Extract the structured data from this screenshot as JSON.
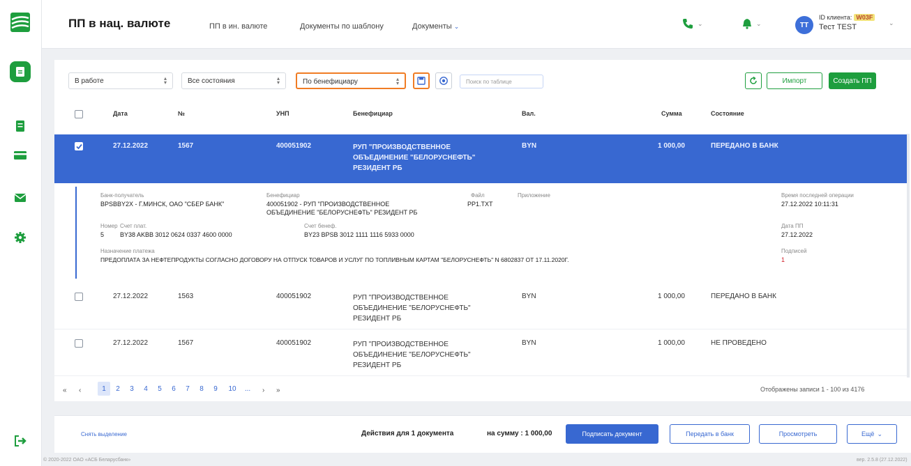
{
  "header": {
    "title": "ПП в нац. валюте",
    "nav": [
      "ПП в ин. валюте",
      "Документы по шаблону",
      "Документы"
    ],
    "client_id_label": "ID клиента:",
    "client_id_value": "W03F",
    "client_name": "Тест TEST",
    "avatar_initials": "TT"
  },
  "filters": {
    "work": "В работе",
    "states": "Все состояния",
    "group_by": "По бенефициару",
    "search_placeholder": "Поиск по таблице"
  },
  "toolbar": {
    "import": "Импорт",
    "create": "Создать ПП"
  },
  "table": {
    "headers": [
      "Дата",
      "№",
      "УНП",
      "Бенефициар",
      "Вал.",
      "Сумма",
      "Состояние"
    ],
    "rows": [
      {
        "checked": true,
        "date": "27.12.2022",
        "num": "1567",
        "unp": "400051902",
        "benef": [
          "РУП \"ПРОИЗВОДСТВЕННОЕ",
          "ОБЪЕДИНЕНИЕ \"БЕЛОРУСНЕФТЬ\"",
          "РЕЗИДЕНТ РБ"
        ],
        "cur": "BYN",
        "sum": "1 000,00",
        "state": "ПЕРЕДАНО В БАНК"
      },
      {
        "checked": false,
        "date": "27.12.2022",
        "num": "1563",
        "unp": "400051902",
        "benef": [
          "РУП \"ПРОИЗВОДСТВЕННОЕ",
          "ОБЪЕДИНЕНИЕ \"БЕЛОРУСНЕФТЬ\"",
          "РЕЗИДЕНТ РБ"
        ],
        "cur": "BYN",
        "sum": "1 000,00",
        "state": "ПЕРЕДАНО В БАНК"
      },
      {
        "checked": false,
        "date": "27.12.2022",
        "num": "1567",
        "unp": "400051902",
        "benef": [
          "РУП \"ПРОИЗВОДСТВЕННОЕ",
          "ОБЪЕДИНЕНИЕ \"БЕЛОРУСНЕФТЬ\"",
          "РЕЗИДЕНТ РБ"
        ],
        "cur": "BYN",
        "sum": "1 000,00",
        "state": "НЕ ПРОВЕДЕНО"
      }
    ]
  },
  "detail": {
    "bank_label": "Банк-получатель",
    "bank_value": "BPSBBY2X - Г.МИНСК, ОАО \"СБЕР БАНК\"",
    "benef_label": "Бенефициар",
    "benef_value_1": "400051902 - РУП \"ПРОИЗВОДСТВЕННОЕ",
    "benef_value_2": "ОБЪЕДИНЕНИЕ \"БЕЛОРУСНЕФТЬ\" РЕЗИДЕНТ РБ",
    "file_label": "Файл",
    "file_value": "PP1.TXT",
    "attach_label": "Приложение",
    "last_op_label": "Время последней операции",
    "last_op_value": "27.12.2022 10:11:31",
    "number_label": "Номер",
    "number_value": "5",
    "payer_acc_label": "Счет плат.",
    "payer_acc_value": "BY38 AKBB 3012 0624 0337 4600 0000",
    "benef_acc_label": "Счет бенеф.",
    "benef_acc_value": "BY23 BPSB 3012 1111 1116 5933 0000",
    "pp_date_label": "Дата ПП",
    "pp_date_value": "27.12.2022",
    "purpose_label": "Назначение платежа",
    "purpose_value": "ПРЕДОПЛАТА ЗА НЕФТЕПРОДУКТЫ СОГЛАСНО ДОГОВОРУ НА ОТПУСК ТОВАРОВ И УСЛУГ ПО ТОПЛИВНЫМ КАРТАМ \"БЕЛОРУСНЕФТЬ\" N 6802837 ОТ 17.11.2020Г.",
    "signatures_label": "Подписей",
    "signatures_value": "1"
  },
  "pagination": {
    "pages": [
      "1",
      "2",
      "3",
      "4",
      "5",
      "6",
      "7",
      "8",
      "9",
      "10",
      "..."
    ],
    "shown": "Отображены записи 1 - 100 из 4176"
  },
  "footer": {
    "unselect": "Снять выделение",
    "actions": "Действия для 1 документа",
    "sum": "на сумму : 1 000,00",
    "sign": "Подписать документ",
    "send": "Передать в банк",
    "view": "Просмотреть",
    "more": "Ещё",
    "copyright": "© 2020-2022 ОАО «АСБ Беларусбанк»",
    "version": "вер. 2.5.8 (27.12.2022)"
  },
  "colors": {
    "brand": "#1e9e3e",
    "accent": "#3868d1",
    "highlight": "#f07c24"
  }
}
